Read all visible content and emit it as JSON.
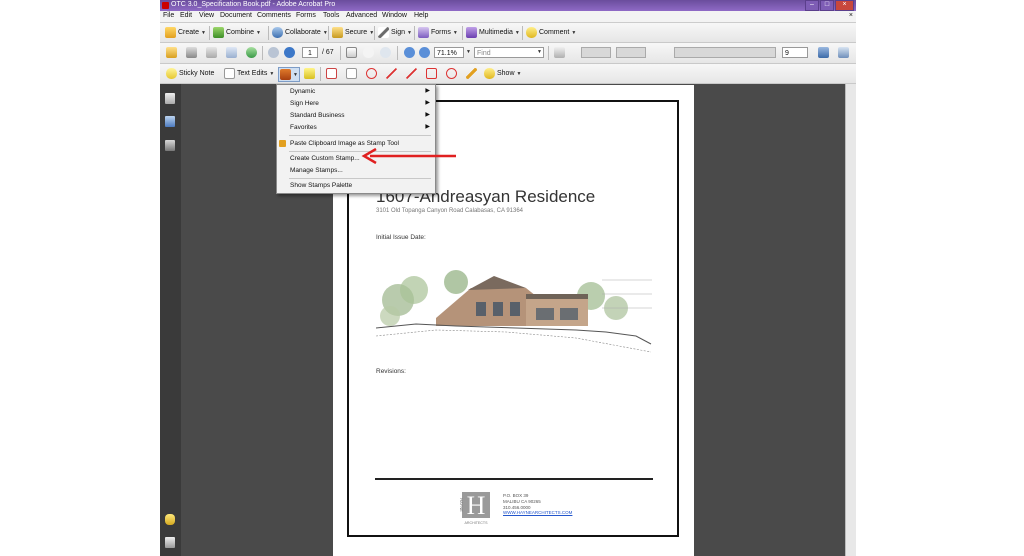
{
  "window": {
    "title": "OTC 3.0_Specification Book.pdf - Adobe Acrobat Pro",
    "buttons": [
      "–",
      "□",
      "×"
    ]
  },
  "menubar": [
    "File",
    "Edit",
    "View",
    "Document",
    "Comments",
    "Forms",
    "Tools",
    "Advanced",
    "Window",
    "Help"
  ],
  "toolbar1": [
    "Create",
    "Combine",
    "Collaborate",
    "Secure",
    "Sign",
    "Forms",
    "Multimedia",
    "Comment"
  ],
  "toolbar2": {
    "page_current": "1",
    "page_total": "/ 67",
    "zoom": "71.1%",
    "find_placeholder": "Find",
    "font_size": "9"
  },
  "toolbar3": {
    "sticky_note": "Sticky Note",
    "text_edits": "Text Edits",
    "show": "Show"
  },
  "stamp_menu": {
    "items": [
      "Dynamic",
      "Sign Here",
      "Standard Business",
      "Favorites",
      "Paste Clipboard Image as Stamp Tool",
      "Create Custom Stamp...",
      "Manage Stamps...",
      "Show Stamps Palette"
    ]
  },
  "document": {
    "title": "1607-Andreasyan Residence",
    "address": "3101 Old Topanga Canyon Road Calabasas, CA 91364",
    "initial_issue_label": "Initial Issue Date:",
    "revisions_label": "Revisions:",
    "logo_letter": "H",
    "logo_side_text": "HAYNE",
    "logo_bottom_text": "ARCHITECTS",
    "contact": [
      "P.O. BOX 39",
      "MALIBU CA 90265",
      "310.456.0000",
      "WWW.HAYNEARCHITECTS.COM"
    ]
  },
  "colors": {
    "title_bar": "#7b58b3",
    "annotation_arrow": "#e02020",
    "workspace": "#4a4a4a"
  }
}
